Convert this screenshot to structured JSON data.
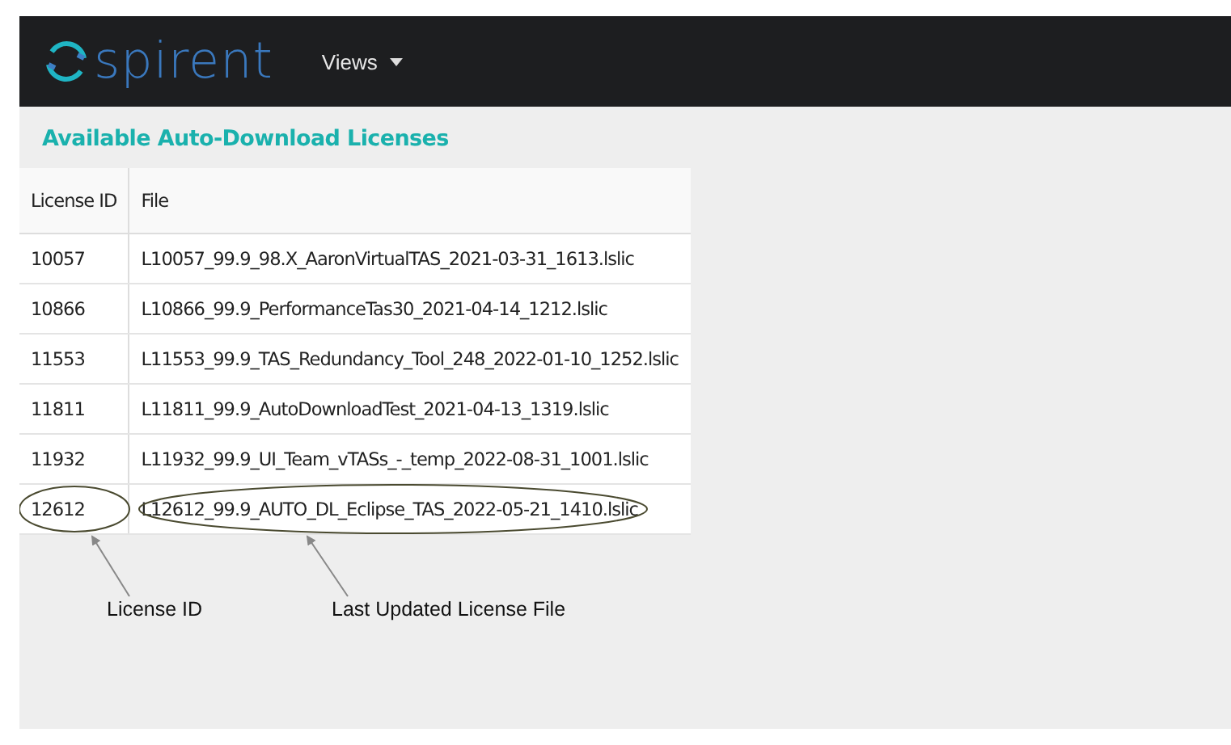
{
  "navbar": {
    "logo_text": "spirent",
    "menu": [
      {
        "label": "Views"
      }
    ]
  },
  "heading": "Available Auto-Download Licenses",
  "table": {
    "columns": [
      "License ID",
      "File"
    ],
    "rows": [
      {
        "license_id": "10057",
        "file": "L10057_99.9_98.X_AaronVirtualTAS_2021-03-31_1613.lslic"
      },
      {
        "license_id": "10866",
        "file": "L10866_99.9_PerformanceTas30_2021-04-14_1212.lslic"
      },
      {
        "license_id": "11553",
        "file": "L11553_99.9_TAS_Redundancy_Tool_248_2022-01-10_1252.lslic"
      },
      {
        "license_id": "11811",
        "file": "L11811_99.9_AutoDownloadTest_2021-04-13_1319.lslic"
      },
      {
        "license_id": "11932",
        "file": "L11932_99.9_UI_Team_vTASs_-_temp_2022-08-31_1001.lslic"
      },
      {
        "license_id": "12612",
        "file": "L12612_99.9_AUTO_DL_Eclipse_TAS_2022-05-21_1410.lslic"
      }
    ]
  },
  "callouts": [
    {
      "label": "License ID"
    },
    {
      "label": "Last Updated License File"
    }
  ]
}
